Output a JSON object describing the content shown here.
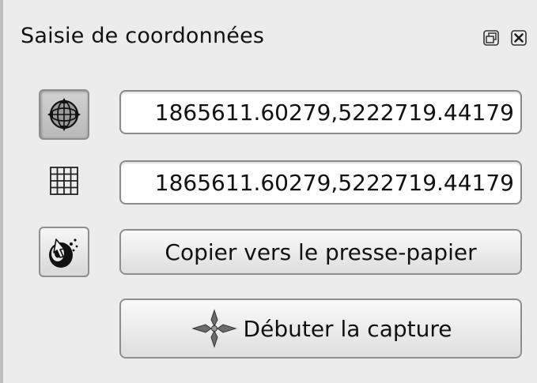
{
  "panel": {
    "title": "Saisie de coordonnées",
    "float_icon": "float-dock-icon",
    "close_icon": "close-icon"
  },
  "rows": {
    "canvas_coord": {
      "icon": "projection-globe-icon",
      "value": "1865611.60279,5222719.44179"
    },
    "projected_coord": {
      "icon": "grid-icon",
      "value": "1865611.60279,5222719.44179"
    },
    "copy": {
      "icon": "mouse-pointer-icon",
      "label": "Copier vers le presse-papier"
    },
    "capture": {
      "icon": "crosshair-capture-icon",
      "label": "Débuter la capture"
    }
  }
}
